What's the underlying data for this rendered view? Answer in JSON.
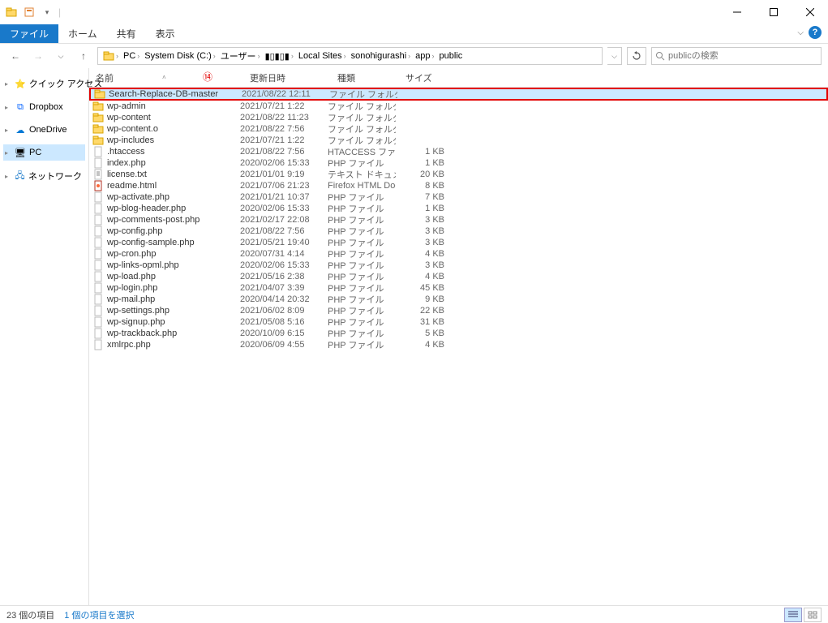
{
  "ribbon": {
    "file": "ファイル",
    "home": "ホーム",
    "share": "共有",
    "view": "表示"
  },
  "breadcrumb": {
    "segments": [
      "PC",
      "System Disk (C:)",
      "ユーザー",
      "▮▯▮▯▮",
      "Local Sites",
      "sonohigurashi",
      "app",
      "public"
    ]
  },
  "search": {
    "placeholder": "publicの検索"
  },
  "sidebar": {
    "quick_access": "クイック アクセス",
    "dropbox": "Dropbox",
    "onedrive": "OneDrive",
    "pc": "PC",
    "network": "ネットワーク"
  },
  "columns": {
    "name": "名前",
    "date": "更新日時",
    "type": "種類",
    "size": "サイズ"
  },
  "annotation": "⑭",
  "files": [
    {
      "icon": "folder",
      "name": "Search-Replace-DB-master",
      "date": "2021/08/22 12:11",
      "type": "ファイル フォルダー",
      "size": "",
      "selected": true
    },
    {
      "icon": "folder",
      "name": "wp-admin",
      "date": "2021/07/21 1:22",
      "type": "ファイル フォルダー",
      "size": ""
    },
    {
      "icon": "folder",
      "name": "wp-content",
      "date": "2021/08/22 11:23",
      "type": "ファイル フォルダー",
      "size": ""
    },
    {
      "icon": "folder",
      "name": "wp-content.o",
      "date": "2021/08/22 7:56",
      "type": "ファイル フォルダー",
      "size": ""
    },
    {
      "icon": "folder",
      "name": "wp-includes",
      "date": "2021/07/21 1:22",
      "type": "ファイル フォルダー",
      "size": ""
    },
    {
      "icon": "file",
      "name": ".htaccess",
      "date": "2021/08/22 7:56",
      "type": "HTACCESS ファイル",
      "size": "1 KB"
    },
    {
      "icon": "php",
      "name": "index.php",
      "date": "2020/02/06 15:33",
      "type": "PHP ファイル",
      "size": "1 KB"
    },
    {
      "icon": "txt",
      "name": "license.txt",
      "date": "2021/01/01 9:19",
      "type": "テキスト ドキュメント",
      "size": "20 KB"
    },
    {
      "icon": "html",
      "name": "readme.html",
      "date": "2021/07/06 21:23",
      "type": "Firefox HTML Docum...",
      "size": "8 KB"
    },
    {
      "icon": "php",
      "name": "wp-activate.php",
      "date": "2021/01/21 10:37",
      "type": "PHP ファイル",
      "size": "7 KB"
    },
    {
      "icon": "php",
      "name": "wp-blog-header.php",
      "date": "2020/02/06 15:33",
      "type": "PHP ファイル",
      "size": "1 KB"
    },
    {
      "icon": "php",
      "name": "wp-comments-post.php",
      "date": "2021/02/17 22:08",
      "type": "PHP ファイル",
      "size": "3 KB"
    },
    {
      "icon": "php",
      "name": "wp-config.php",
      "date": "2021/08/22 7:56",
      "type": "PHP ファイル",
      "size": "3 KB"
    },
    {
      "icon": "php",
      "name": "wp-config-sample.php",
      "date": "2021/05/21 19:40",
      "type": "PHP ファイル",
      "size": "3 KB"
    },
    {
      "icon": "php",
      "name": "wp-cron.php",
      "date": "2020/07/31 4:14",
      "type": "PHP ファイル",
      "size": "4 KB"
    },
    {
      "icon": "php",
      "name": "wp-links-opml.php",
      "date": "2020/02/06 15:33",
      "type": "PHP ファイル",
      "size": "3 KB"
    },
    {
      "icon": "php",
      "name": "wp-load.php",
      "date": "2021/05/16 2:38",
      "type": "PHP ファイル",
      "size": "4 KB"
    },
    {
      "icon": "php",
      "name": "wp-login.php",
      "date": "2021/04/07 3:39",
      "type": "PHP ファイル",
      "size": "45 KB"
    },
    {
      "icon": "php",
      "name": "wp-mail.php",
      "date": "2020/04/14 20:32",
      "type": "PHP ファイル",
      "size": "9 KB"
    },
    {
      "icon": "php",
      "name": "wp-settings.php",
      "date": "2021/06/02 8:09",
      "type": "PHP ファイル",
      "size": "22 KB"
    },
    {
      "icon": "php",
      "name": "wp-signup.php",
      "date": "2021/05/08 5:16",
      "type": "PHP ファイル",
      "size": "31 KB"
    },
    {
      "icon": "php",
      "name": "wp-trackback.php",
      "date": "2020/10/09 6:15",
      "type": "PHP ファイル",
      "size": "5 KB"
    },
    {
      "icon": "php",
      "name": "xmlrpc.php",
      "date": "2020/06/09 4:55",
      "type": "PHP ファイル",
      "size": "4 KB"
    }
  ],
  "status": {
    "count": "23 個の項目",
    "selection": "1 個の項目を選択"
  }
}
